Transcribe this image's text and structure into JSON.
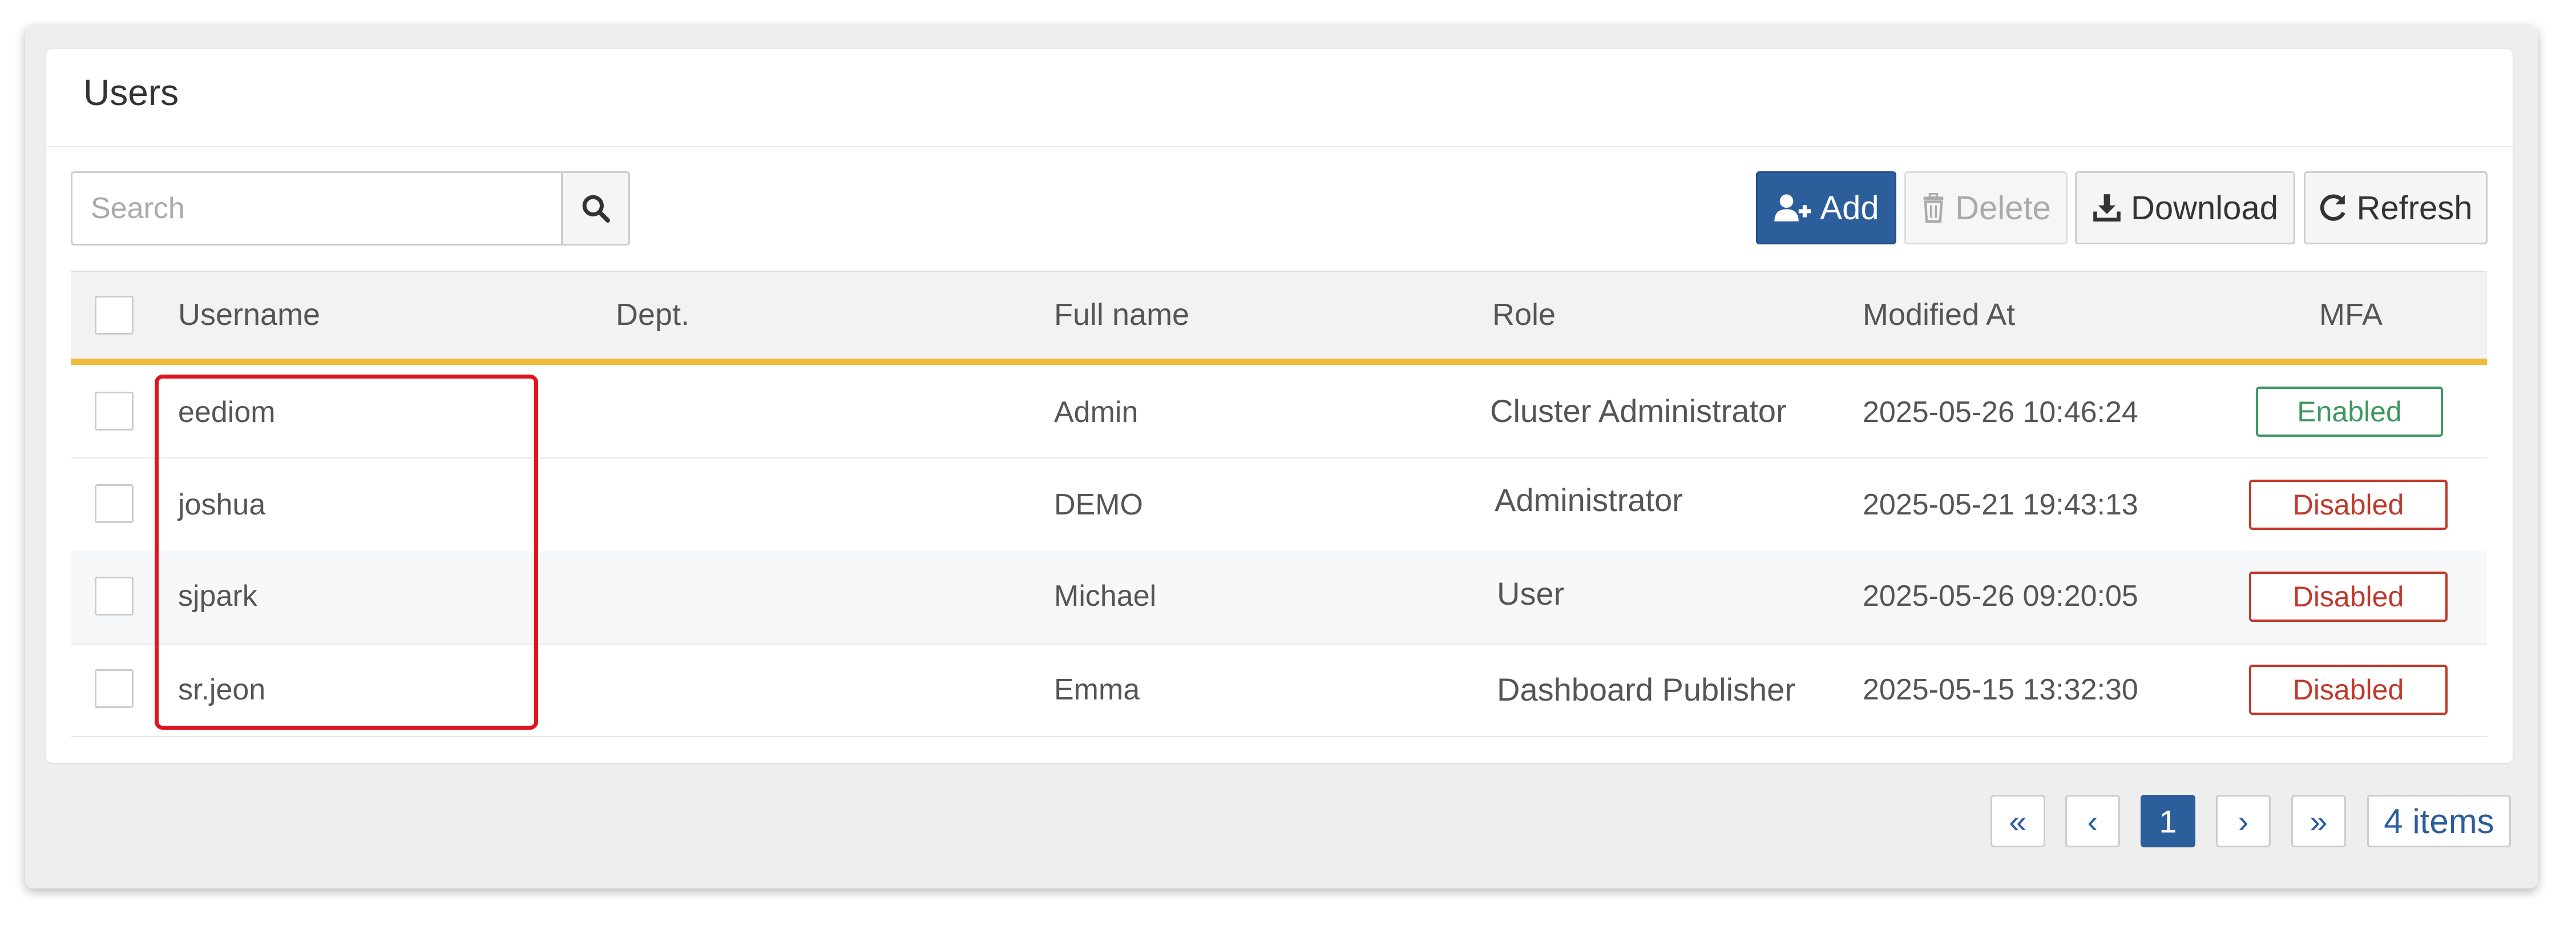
{
  "card": {
    "title": "Users"
  },
  "search": {
    "placeholder": "Search",
    "icon": "search-icon"
  },
  "toolbar": {
    "add_label": "Add",
    "delete_label": "Delete",
    "download_label": "Download",
    "refresh_label": "Refresh"
  },
  "table": {
    "columns": {
      "username": "Username",
      "dept": "Dept.",
      "fullname": "Full name",
      "role": "Role",
      "modified": "Modified At",
      "mfa": "MFA"
    },
    "rows": [
      {
        "username": "eediom",
        "dept": "",
        "fullname": "Admin",
        "role": "Cluster Administrator",
        "modified": "2025-05-26 10:46:24",
        "mfa": "Enabled"
      },
      {
        "username": "joshua",
        "dept": "",
        "fullname": "DEMO",
        "role": "Administrator",
        "modified": "2025-05-21 19:43:13",
        "mfa": "Disabled"
      },
      {
        "username": "sjpark",
        "dept": "",
        "fullname": "Michael",
        "role": "User",
        "modified": "2025-05-26 09:20:05",
        "mfa": "Disabled"
      },
      {
        "username": "sr.jeon",
        "dept": "",
        "fullname": "Emma",
        "role": "Dashboard Publisher",
        "modified": "2025-05-15 13:32:30",
        "mfa": "Disabled"
      }
    ]
  },
  "pagination": {
    "first": "«",
    "prev": "‹",
    "current": "1",
    "next": "›",
    "last": "»",
    "total": "4 items"
  },
  "colors": {
    "primary": "#2b5e9b",
    "header_accent": "#f0bb3d",
    "enabled": "#3c9a5f",
    "disabled": "#c0392b",
    "highlight": "#e0141e"
  }
}
